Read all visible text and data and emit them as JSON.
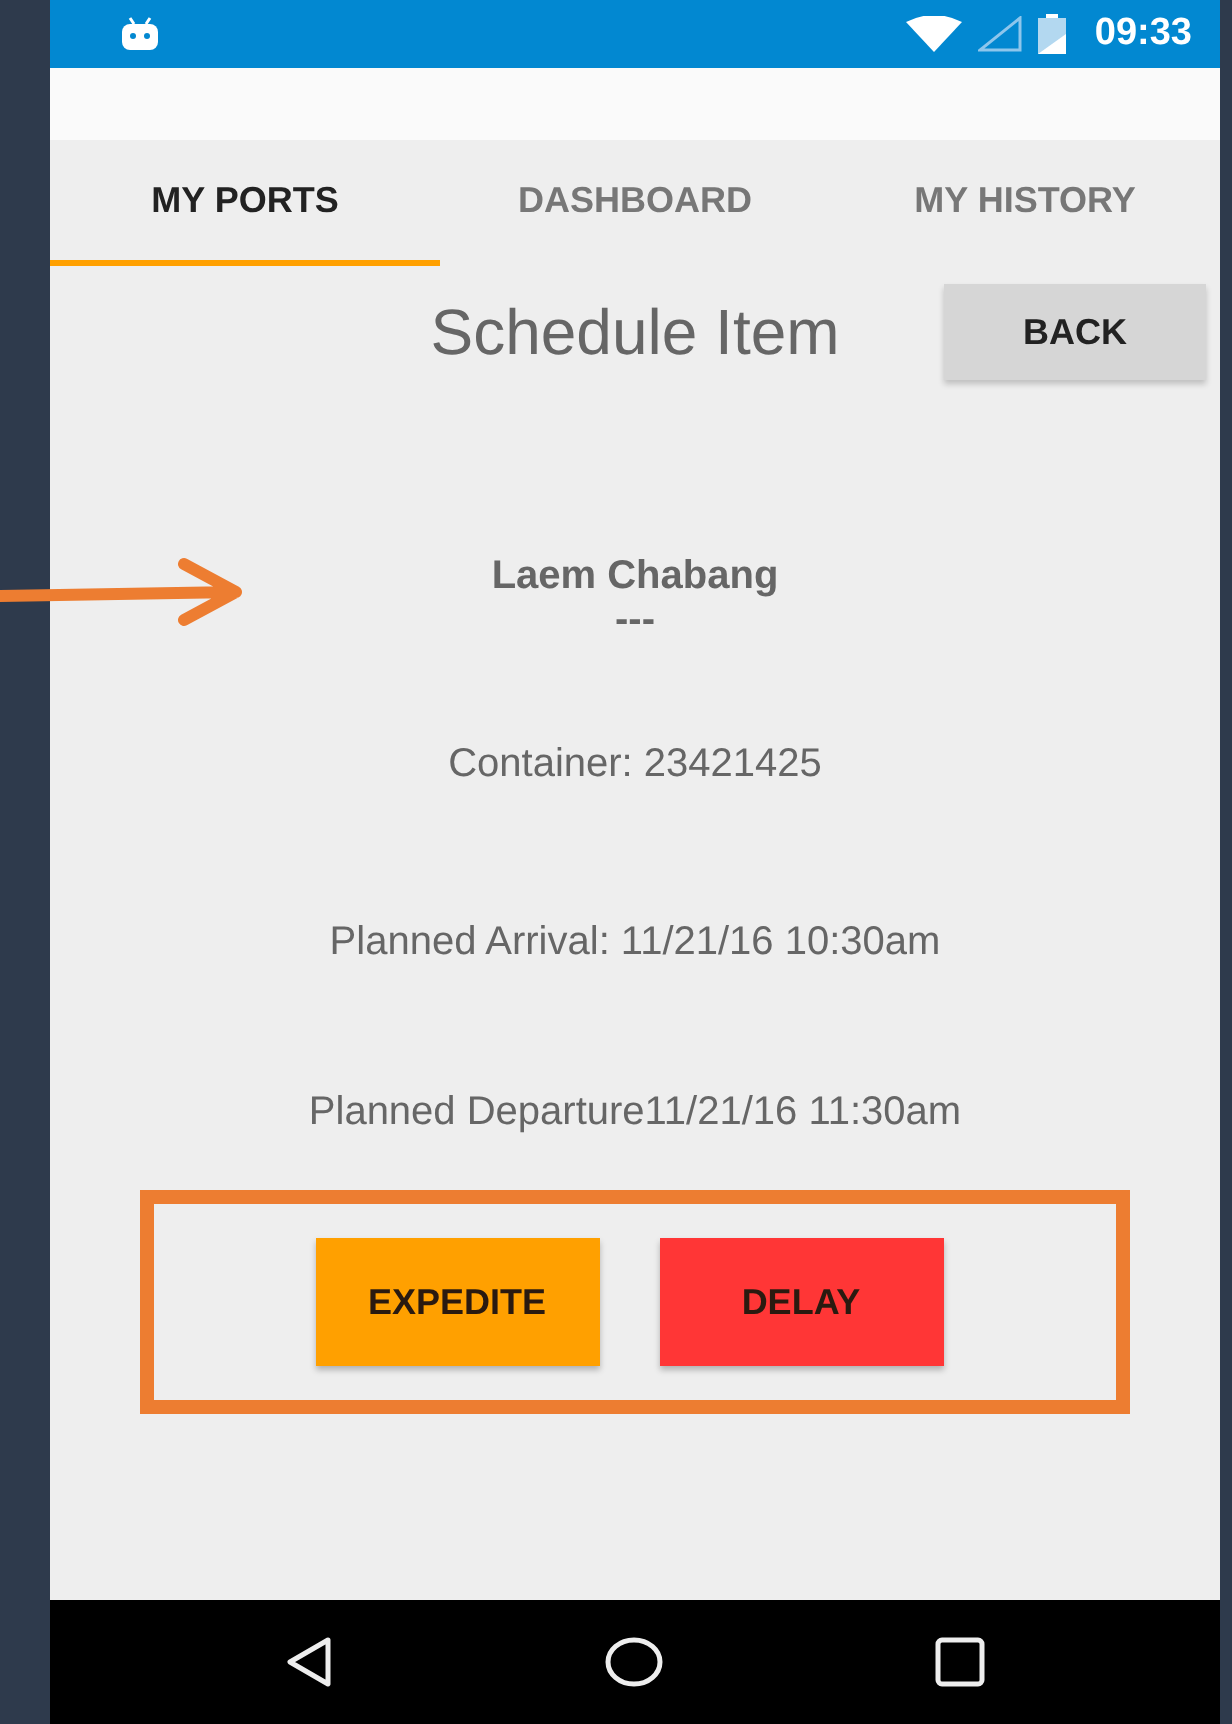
{
  "status_bar": {
    "time": "09:33"
  },
  "tabs": [
    {
      "label": "MY PORTS",
      "selected": true
    },
    {
      "label": "DASHBOARD",
      "selected": false
    },
    {
      "label": "MY HISTORY",
      "selected": false
    }
  ],
  "screen": {
    "title": "Schedule Item",
    "back_button": "BACK"
  },
  "schedule_item": {
    "port": "Laem Chabang",
    "separator": "---",
    "container": "Container: 23421425",
    "planned_arrival": "Planned Arrival: 11/21/16 10:30am",
    "planned_departure": "Planned Departure11/21/16 11:30am"
  },
  "actions": [
    {
      "label": "EXPEDITE",
      "color": "#ffa000"
    },
    {
      "label": "DELAY",
      "color": "#ff3636"
    }
  ]
}
